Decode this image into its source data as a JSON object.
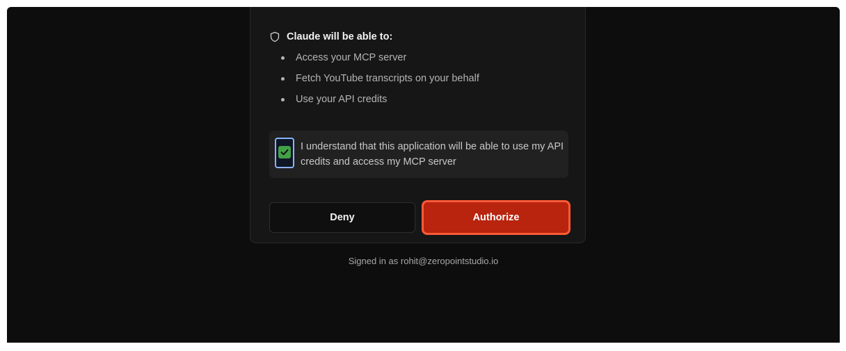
{
  "colors": {
    "background": "#0d0d0d",
    "card": "#161616",
    "accent": "#b8240e",
    "accent_border": "#ff5a36",
    "check": "#43a047"
  },
  "permissions": {
    "icon": "shield-icon",
    "title": "Claude will be able to:",
    "items": [
      {
        "label": "Access your MCP server"
      },
      {
        "label": "Fetch YouTube transcripts on your behalf"
      },
      {
        "label": "Use your API credits"
      }
    ]
  },
  "consent": {
    "checked": true,
    "text": "I understand that this application will be able to use my API credits and access my MCP server"
  },
  "actions": {
    "deny_label": "Deny",
    "authorize_label": "Authorize"
  },
  "footer": {
    "signed_in_text": "Signed in as rohit@zeropointstudio.io"
  }
}
